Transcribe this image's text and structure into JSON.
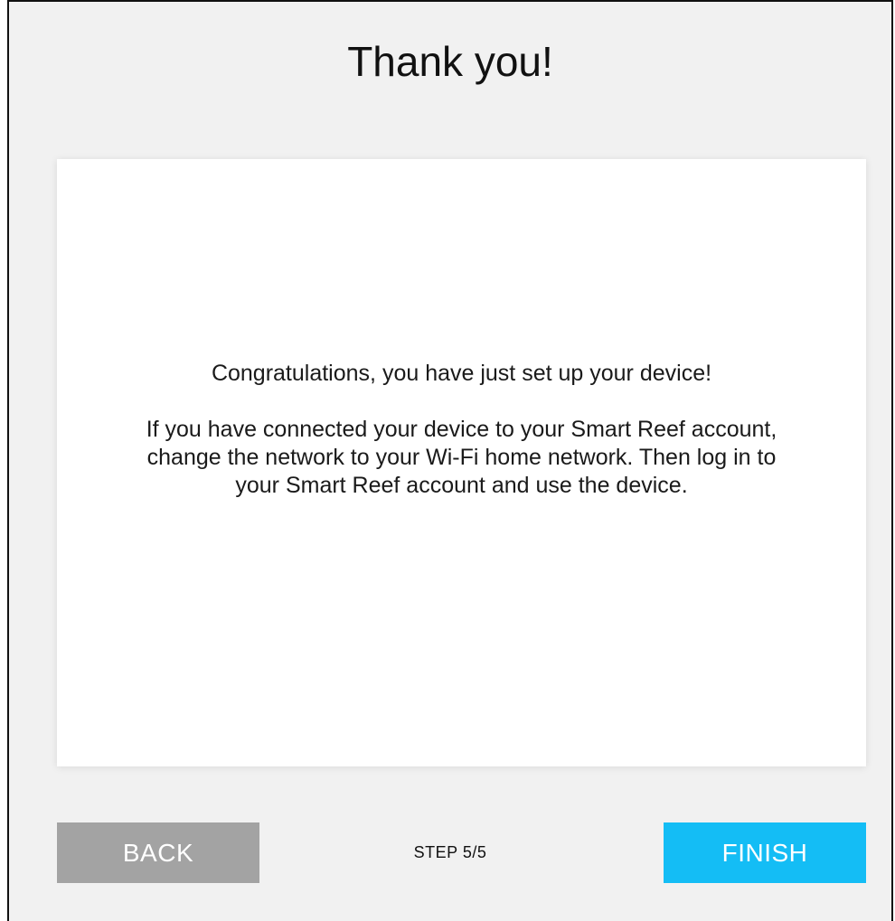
{
  "page": {
    "title": "Thank you!"
  },
  "card": {
    "headline": "Congratulations, you have just set up your device!",
    "body": "If you have connected your device to your Smart Reef account, change the network to your Wi-Fi home network. Then log in to your Smart Reef account and use the device."
  },
  "footer": {
    "back_label": "BACK",
    "step_label": "STEP 5/5",
    "finish_label": "FINISH"
  },
  "colors": {
    "background": "#f1f1f1",
    "card": "#ffffff",
    "back_button": "#a3a3a3",
    "finish_button": "#14bdf5"
  }
}
